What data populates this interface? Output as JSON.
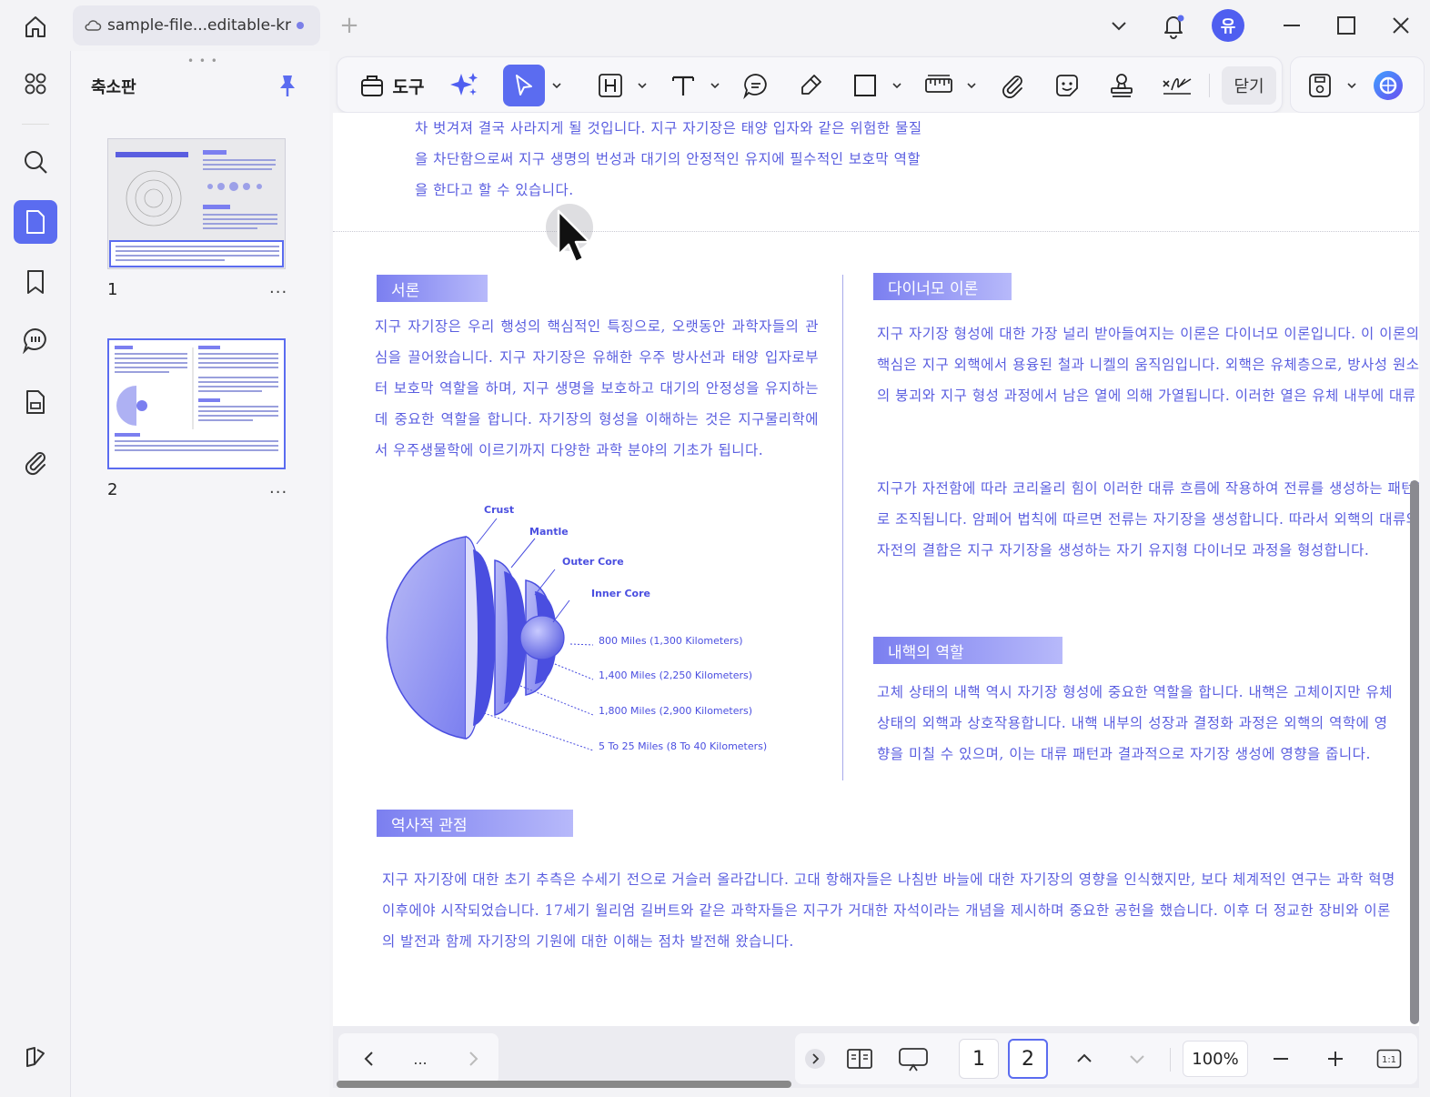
{
  "window": {
    "tab_title": "sample-file...editable-kr",
    "avatar_label": "유"
  },
  "sidebar": {
    "panel_title": "축소판",
    "pages": [
      {
        "number": "1",
        "more": "..."
      },
      {
        "number": "2",
        "more": "..."
      }
    ],
    "icons": [
      "grid-icon",
      "search-icon",
      "pages-icon",
      "bookmark-icon",
      "comment-icon",
      "form-icon",
      "attachment-icon",
      "layers-icon"
    ]
  },
  "toolbar": {
    "tools_label": "도구",
    "close_label": "닫기"
  },
  "document": {
    "prev_page_text": "차 벗겨져 결국 사라지게 될 것입니다. 지구 자기장은 태양 입자와 같은 위험한 물질을 차단함으로써 지구 생명의 번성과 대기의 안정적인 유지에 필수적인 보호막 역할을 한다고 할 수 있습니다.",
    "intro": {
      "heading": "서론",
      "body": "지구 자기장은 우리 행성의 핵심적인 특징으로, 오랫동안 과학자들의 관심을 끌어왔습니다. 지구 자기장은 유해한 우주 방사선과 태양 입자로부터 보호막 역할을 하며, 지구 생명을 보호하고 대기의 안정성을 유지하는 데 중요한 역할을 합니다. 자기장의 형성을 이해하는 것은 지구물리학에서 우주생물학에 이르기까지 다양한 과학 분야의 기초가 됩니다."
    },
    "earth_diagram": {
      "labels": [
        "Crust",
        "Mantle",
        "Outer Core",
        "Inner Core"
      ],
      "distances": [
        "800 Miles (1,300 Kilometers)",
        "1,400 Miles (2,250 Kilometers)",
        "1,800 Miles (2,900 Kilometers)",
        "5 To 25 Miles (8 To 40 Kilometers)"
      ]
    },
    "dynamo": {
      "heading": "다이너모 이론",
      "para1": "지구 자기장 형성에 대한 가장 널리 받아들여지는 이론은 다이너모 이론입니다. 이 이론의 핵심은 지구 외핵에서 용융된 철과 니켈의 움직임입니다. 외핵은 유체층으로, 방사성 원소의 붕괴와 지구 형성 과정에서 남은 열에 의해 가열됩니다. 이러한 열은 유체 내부에 대류",
      "para2": "지구가 자전함에 따라 코리올리 힘이 이러한 대류 흐름에 작용하여 전류를 생성하는 패턴으로 조직됩니다. 암페어 법칙에 따르면 전류는 자기장을 생성합니다. 따라서 외핵의 대류와 자전의 결합은 지구 자기장을 생성하는 자기 유지형 다이너모 과정을 형성합니다."
    },
    "inner_core": {
      "heading": "내핵의 역할",
      "body": "고체 상태의 내핵 역시 자기장 형성에 중요한 역할을 합니다. 내핵은 고체이지만 유체 상태의 외핵과 상호작용합니다. 내핵 내부의 성장과 결정화 과정은 외핵의 역학에 영향을 미칠 수 있으며, 이는 대류 패턴과 결과적으로 자기장 생성에 영향을 줍니다."
    },
    "history": {
      "heading": "역사적 관점",
      "body": "지구 자기장에 대한 초기 추측은 수세기 전으로 거슬러 올라갑니다. 고대 항해자들은 나침반 바늘에 대한 자기장의 영향을 인식했지만, 보다 체계적인 연구는 과학 혁명 이후에야 시작되었습니다. 17세기 윌리엄 길버트와 같은 과학자들은 지구가 거대한 자석이라는 개념을 제시하며 중요한 공헌을 했습니다. 이후 더 정교한 장비와 이론의 발전과 함께 자기장의 기원에 대한 이해는 점차 발전해 왔습니다."
    }
  },
  "bottom": {
    "ellipsis": "...",
    "page_1": "1",
    "page_2": "2",
    "current_page": 2,
    "zoom": "100%",
    "actual_size_label": "1:1"
  },
  "colors": {
    "accent": "#5b6cf0",
    "text_blue": "#5a5ee0",
    "heading_grad_start": "#7b7ff0",
    "heading_grad_end": "#b7b9fa"
  }
}
